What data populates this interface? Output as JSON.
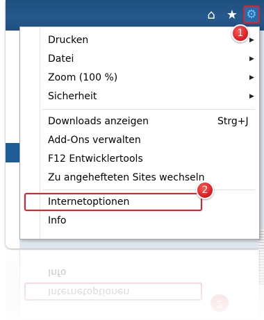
{
  "toolbar": {
    "icons": [
      "home-icon",
      "star-icon",
      "gear-icon"
    ],
    "home_glyph": "⌂",
    "star_glyph": "★",
    "gear_glyph": "⚙"
  },
  "menu": {
    "items": [
      {
        "label": "Drucken",
        "submenu": true
      },
      {
        "label": "Datei",
        "submenu": true
      },
      {
        "label": "Zoom (100 %)",
        "submenu": true
      },
      {
        "label": "Sicherheit",
        "submenu": true
      },
      {
        "label": "Downloads anzeigen",
        "shortcut": "Strg+J"
      },
      {
        "label": "Add-Ons verwalten"
      },
      {
        "label": "F12 Entwicklertools"
      },
      {
        "label": "Zu angehefteten Sites wechseln"
      },
      {
        "label": "Internetoptionen"
      },
      {
        "label": "Info"
      }
    ],
    "submenu_glyph": "▶"
  },
  "annotations": {
    "badge1": "1",
    "badge2": "2"
  },
  "colors": {
    "accent_red": "#d9232d",
    "titlebar_blue": "#26598c",
    "gear_blue": "#66c3ff"
  }
}
